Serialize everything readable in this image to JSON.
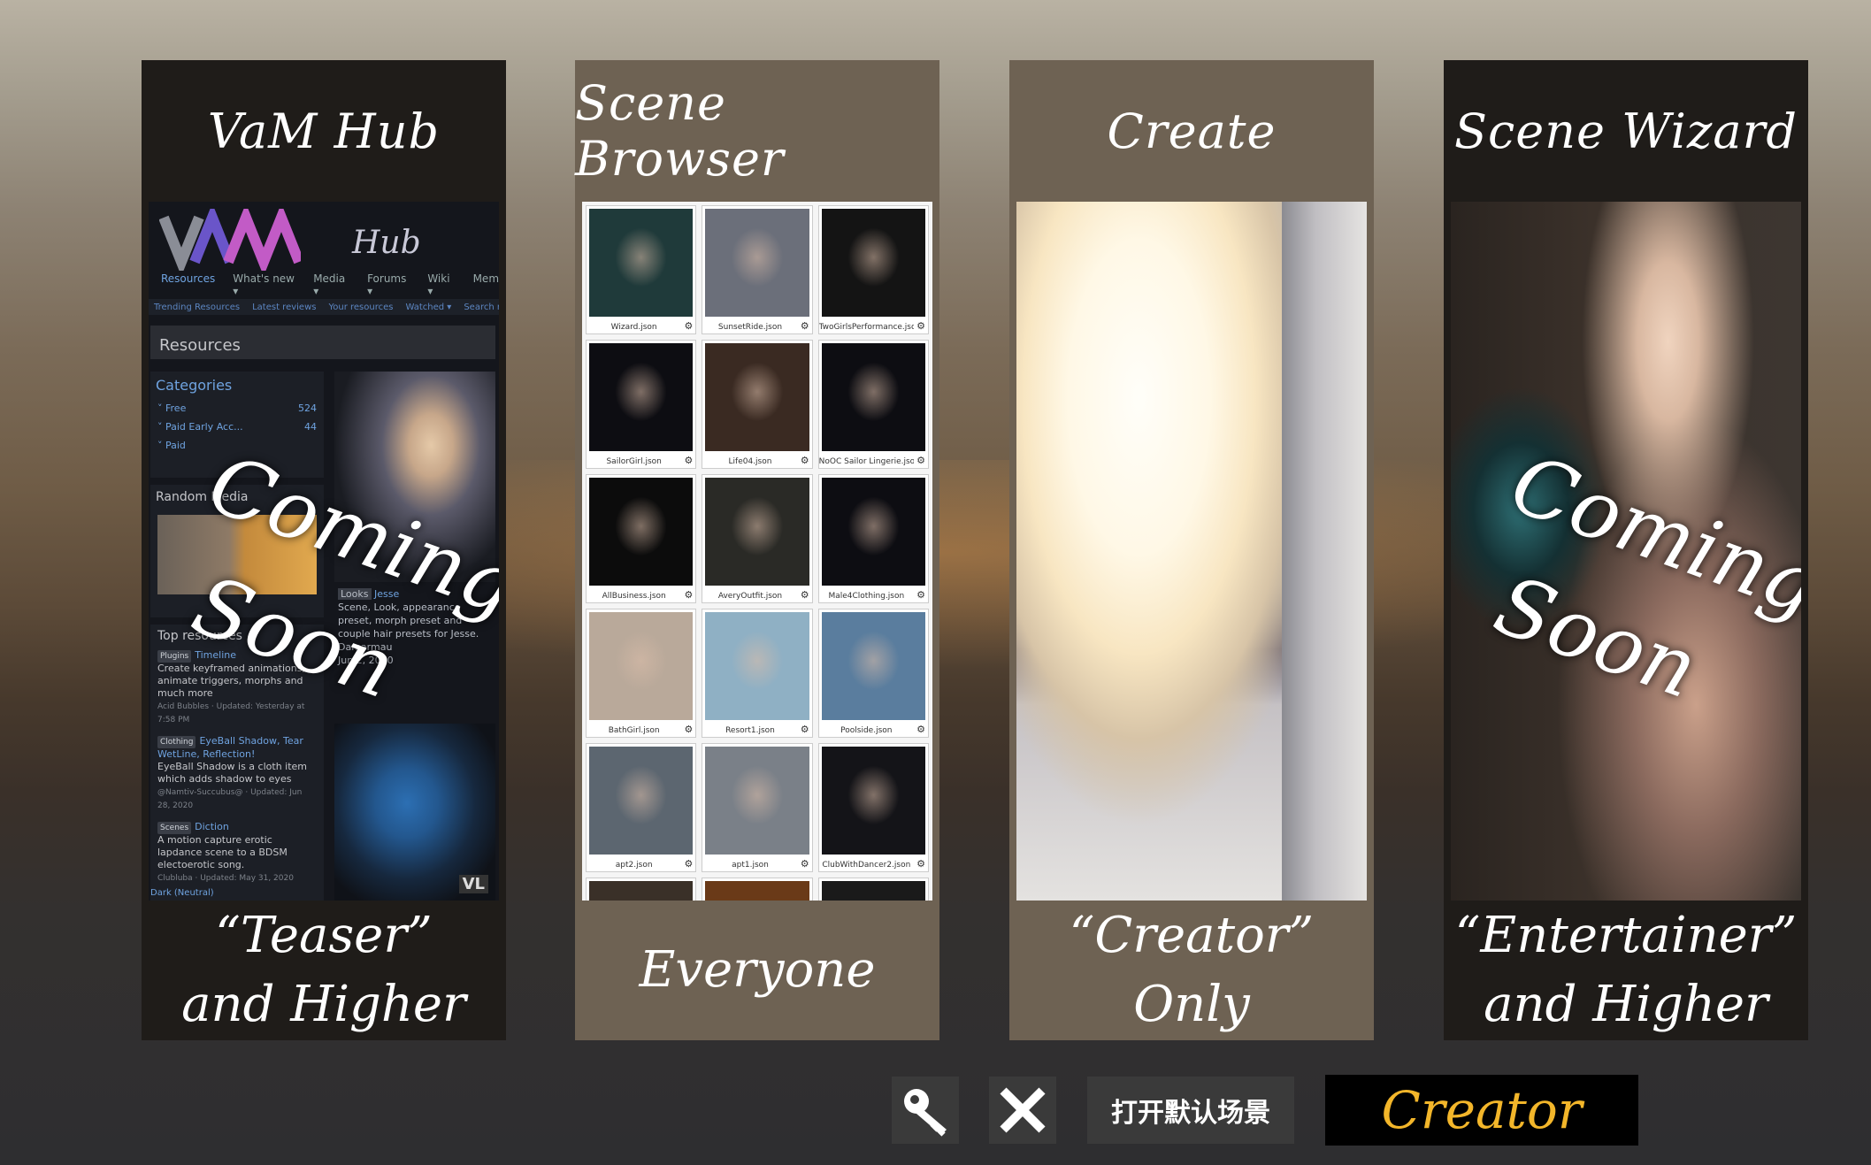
{
  "panels": [
    {
      "title": "VaM Hub",
      "footer_line1": "“Teaser”",
      "footer_line2": "and Higher",
      "coming_word1": "Coming",
      "coming_word2": "Soon"
    },
    {
      "title": "Scene Browser",
      "footer_line1": "Everyone",
      "footer_line2": ""
    },
    {
      "title": "Create",
      "footer_line1": "“Creator”",
      "footer_line2": "Only"
    },
    {
      "title": "Scene Wizard",
      "footer_line1": "“Entertainer”",
      "footer_line2": "and Higher",
      "coming_word1": "Coming",
      "coming_word2": "Soon"
    }
  ],
  "hub": {
    "logo_text": "Hub",
    "nav": [
      "Resources",
      "What's new ▾",
      "Media ▾",
      "Forums ▾",
      "Wiki ▾",
      "Mem"
    ],
    "subnav": [
      "Trending Resources",
      "Latest reviews",
      "Your resources",
      "Watched ▾",
      "Search resources"
    ],
    "resources_heading": "Resources",
    "categories_heading": "Categories",
    "categories": [
      {
        "name": "˅ Free",
        "count": "524"
      },
      {
        "name": "˅ Paid Early Acc...",
        "count": "44"
      },
      {
        "name": "˅ Paid",
        "count": ""
      }
    ],
    "random_media": "Random Media",
    "feature_tag": "Looks",
    "feature_name": "Jesse",
    "feature_desc": "Scene, Look, appearance preset, morph preset and couple hair presets for Jesse.",
    "feature_author": "Damarmau",
    "feature_date": "Jun 2, 2020",
    "top_resources": "Top resources",
    "top_items": [
      {
        "tag": "Plugins",
        "name": "Timeline",
        "desc": "Create keyframed animations, animate triggers, morphs and much more",
        "meta": "Acid Bubbles · Updated: Yesterday at 7:58 PM"
      },
      {
        "tag": "Clothing",
        "name": "EyeBall Shadow, Tear WetLine, Reflection!",
        "desc": "EyeBall Shadow is a cloth item which adds shadow to eyes",
        "meta": "@Namtiv-Succubus@ · Updated: Jun 28, 2020"
      },
      {
        "tag": "Scenes",
        "name": "Diction",
        "desc": "A motion capture erotic lapdance scene to a BDSM electoerotic song.",
        "meta": "Clubluba · Updated: May 31, 2020"
      }
    ],
    "theme_label": "Dark (Neutral)",
    "vl_badge": "VL"
  },
  "scenes": [
    {
      "name": "Wizard.json",
      "color": "#1f3a3a"
    },
    {
      "name": "SunsetRide.json",
      "color": "#6b6f7a"
    },
    {
      "name": "TwoGirlsPerformance.json",
      "color": "#141414"
    },
    {
      "name": "SailorGirl.json",
      "color": "#0d0d12"
    },
    {
      "name": "Life04.json",
      "color": "#3a2a22"
    },
    {
      "name": "NoOC Sailor Lingerie.json",
      "color": "#0d0d12"
    },
    {
      "name": "AllBusiness.json",
      "color": "#0c0c0c"
    },
    {
      "name": "AveryOutfit.json",
      "color": "#2a2a26"
    },
    {
      "name": "Male4Clothing.json",
      "color": "#0d0d12"
    },
    {
      "name": "BathGirl.json",
      "color": "#b9a99a"
    },
    {
      "name": "Resort1.json",
      "color": "#8fb0c4"
    },
    {
      "name": "Poolside.json",
      "color": "#5a7d9e"
    },
    {
      "name": "apt2.json",
      "color": "#5c6670"
    },
    {
      "name": "apt1.json",
      "color": "#7a8088"
    },
    {
      "name": "ClubWithDancer2.json",
      "color": "#141418"
    },
    {
      "name": "",
      "color": "#3a3028"
    },
    {
      "name": "",
      "color": "#6a3a18"
    },
    {
      "name": "",
      "color": "#1a1a1a"
    }
  ],
  "toolbar": {
    "key_icon": "key-icon",
    "close_icon": "close-icon",
    "open_default_scene": "打开默认场景",
    "user_level": "Creator"
  },
  "colors": {
    "accent": "#f3b62a"
  }
}
